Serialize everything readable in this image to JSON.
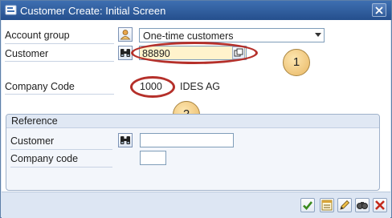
{
  "window": {
    "title": "Customer Create: Initial Screen"
  },
  "form": {
    "account_group_label": "Account group",
    "account_group_value": "One-time customers",
    "customer_label": "Customer",
    "customer_value": "88890",
    "company_code_label": "Company Code",
    "company_code_value": "1000",
    "company_name": "IDES AG"
  },
  "reference": {
    "header": "Reference",
    "customer_label": "Customer",
    "customer_value": "",
    "company_code_label": "Company code",
    "company_code_value": ""
  },
  "annotations": {
    "callout_1": "1",
    "callout_2": "2"
  },
  "colors": {
    "callout_border": "#b5302a",
    "active_field_bg": "#fff3cc",
    "title_bar": "#2f5c9b"
  }
}
